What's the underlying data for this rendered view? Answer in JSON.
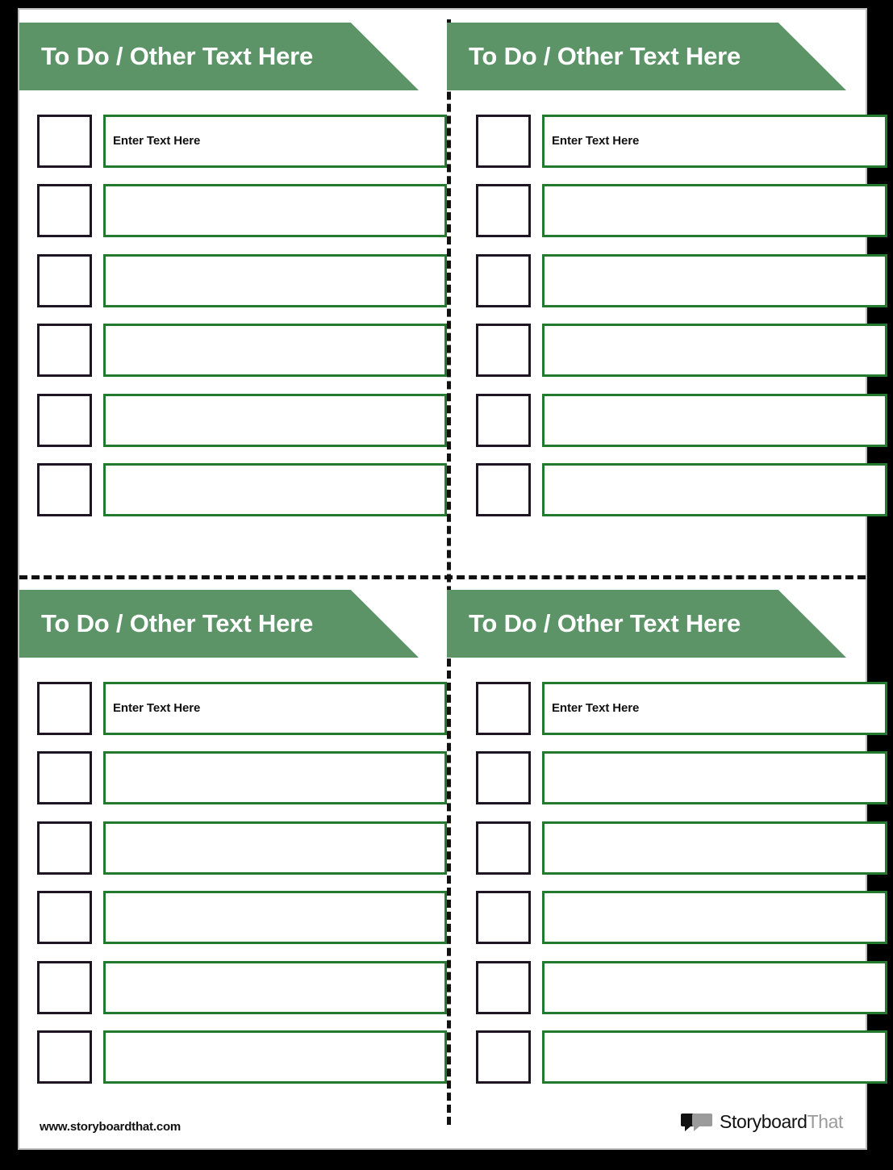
{
  "document": {
    "title": "To Do List Worksheet — four quadrant cut-apart template",
    "background_color": "#000000",
    "sheet_color": "#ffffff",
    "accent_banner_color": "#5c9468",
    "field_border_color": "#237a2f",
    "checkbox_border_color": "#1d1522",
    "divider_style": "dashed"
  },
  "panels": [
    {
      "id": "top-left",
      "header": "To Do / Other Text Here",
      "rows": [
        {
          "checkbox": "",
          "text": "Enter Text Here"
        },
        {
          "checkbox": "",
          "text": ""
        },
        {
          "checkbox": "",
          "text": ""
        },
        {
          "checkbox": "",
          "text": ""
        },
        {
          "checkbox": "",
          "text": ""
        },
        {
          "checkbox": "",
          "text": ""
        }
      ]
    },
    {
      "id": "top-right",
      "header": "To Do / Other Text Here",
      "rows": [
        {
          "checkbox": "",
          "text": "Enter Text Here"
        },
        {
          "checkbox": "",
          "text": ""
        },
        {
          "checkbox": "",
          "text": ""
        },
        {
          "checkbox": "",
          "text": ""
        },
        {
          "checkbox": "",
          "text": ""
        },
        {
          "checkbox": "",
          "text": ""
        }
      ]
    },
    {
      "id": "bottom-left",
      "header": "To Do / Other Text Here",
      "rows": [
        {
          "checkbox": "",
          "text": "Enter Text Here"
        },
        {
          "checkbox": "",
          "text": ""
        },
        {
          "checkbox": "",
          "text": ""
        },
        {
          "checkbox": "",
          "text": ""
        },
        {
          "checkbox": "",
          "text": ""
        },
        {
          "checkbox": "",
          "text": ""
        }
      ]
    },
    {
      "id": "bottom-right",
      "header": "To Do / Other Text Here",
      "rows": [
        {
          "checkbox": "",
          "text": "Enter Text Here"
        },
        {
          "checkbox": "",
          "text": ""
        },
        {
          "checkbox": "",
          "text": ""
        },
        {
          "checkbox": "",
          "text": ""
        },
        {
          "checkbox": "",
          "text": ""
        },
        {
          "checkbox": "",
          "text": ""
        }
      ]
    }
  ],
  "footer": {
    "url": "www.storyboardthat.com",
    "logo": {
      "icon": "speech-bubbles-icon",
      "text_dark": "Storyboard",
      "text_gray": "That"
    }
  }
}
